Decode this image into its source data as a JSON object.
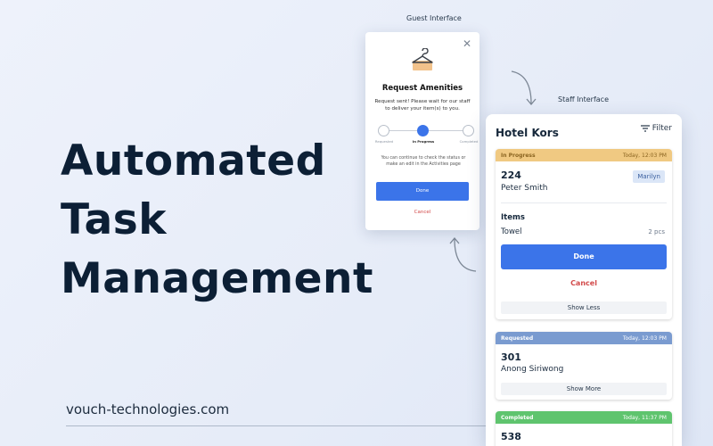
{
  "headline": [
    "Automated",
    "Task",
    "Management"
  ],
  "website": "vouch-technologies.com",
  "captions": {
    "guest": "Guest Interface",
    "staff": "Staff Interface"
  },
  "guest_card": {
    "close_icon": "close-icon",
    "icon": "hanger-icon",
    "title": "Request Amenities",
    "description": "Request sent! Please wait for our staff to deliver your item(s) to you.",
    "steps": [
      "Requested",
      "In Progress",
      "Completed"
    ],
    "active_step": 1,
    "note": "You can continue to check the status or make an edit in the Activities page",
    "done_label": "Done",
    "cancel_label": "Cancel"
  },
  "staff": {
    "title": "Hotel Kors",
    "filter_label": "Filter",
    "filter_icon": "filter-icon",
    "tasks": [
      {
        "status": "In Progress",
        "time": "Today, 12:03 PM",
        "color": "#f0c982",
        "text_color": "#8a6420",
        "room": "224",
        "guest": "Peter Smith",
        "assignee": "Marilyn",
        "items_title": "Items",
        "items": [
          {
            "name": "Towel",
            "qty": "2 pcs"
          }
        ],
        "done_label": "Done",
        "cancel_label": "Cancel",
        "toggle_label": "Show Less"
      },
      {
        "status": "Requested",
        "time": "Today, 12:03 PM",
        "color": "#7a9bd0",
        "text_color": "#ffffff",
        "room": "301",
        "guest": "Anong Siriwong",
        "toggle_label": "Show More"
      },
      {
        "status": "Completed",
        "time": "Today, 11:37 PM",
        "color": "#5fc46e",
        "text_color": "#ffffff",
        "room": "538"
      }
    ]
  }
}
